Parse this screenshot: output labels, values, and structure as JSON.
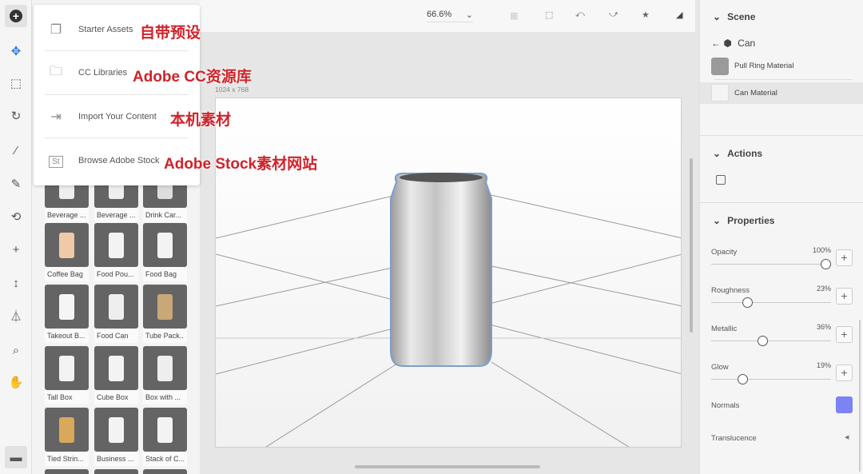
{
  "toolbar": {
    "tools": [
      "add-icon",
      "select-move-icon",
      "frame-icon",
      "rotate-icon",
      "magic-wand-icon",
      "eyedropper-icon",
      "orbit-icon",
      "pan-icon",
      "dolly-icon",
      "perspective-icon",
      "zoom-icon",
      "hand-icon",
      "archive-icon"
    ]
  },
  "add_menu": {
    "items": [
      {
        "label": "Starter Assets",
        "annotation": "自带预设",
        "icon": "stack-icon"
      },
      {
        "label": "CC Libraries",
        "annotation": "Adobe CC资源库",
        "icon": "libraries-icon"
      },
      {
        "label": "Import Your Content",
        "annotation": "本机素材",
        "icon": "import-icon"
      },
      {
        "label": "Browse Adobe Stock",
        "annotation": "Adobe Stock素材网站",
        "icon": "stock-icon",
        "icon_text": "St"
      }
    ]
  },
  "assets": [
    "Beverage ...",
    "Beverage ...",
    "Drink Car...",
    "Coffee Bag",
    "Food Pou...",
    "Food Bag",
    "Takeout B...",
    "Food Can",
    "Tube Pack..",
    "Tall Box",
    "Cube Box",
    "Box with ...",
    "Tied Strin...",
    "Business ...",
    "Stack of C..."
  ],
  "topbar": {
    "zoom": "66.6%"
  },
  "canvas": {
    "size": "1024 x 768"
  },
  "scene": {
    "title": "Scene",
    "object": "Can",
    "materials": [
      {
        "name": "Pull Ring Material",
        "swatch": "#9a9a9a"
      },
      {
        "name": "Can Material",
        "swatch": "#f4f4f4",
        "selected": true
      }
    ]
  },
  "actions": {
    "title": "Actions"
  },
  "properties": {
    "title": "Properties",
    "sliders": [
      {
        "label": "Opacity",
        "value": "100%",
        "fraction": 1.0
      },
      {
        "label": "Roughness",
        "value": "23%",
        "fraction": 0.23
      },
      {
        "label": "Metallic",
        "value": "36%",
        "fraction": 0.36
      },
      {
        "label": "Glow",
        "value": "19%",
        "fraction": 0.19
      }
    ],
    "normals": {
      "label": "Normals",
      "color": "#7b83f5"
    },
    "translucence": {
      "label": "Translucence"
    }
  }
}
